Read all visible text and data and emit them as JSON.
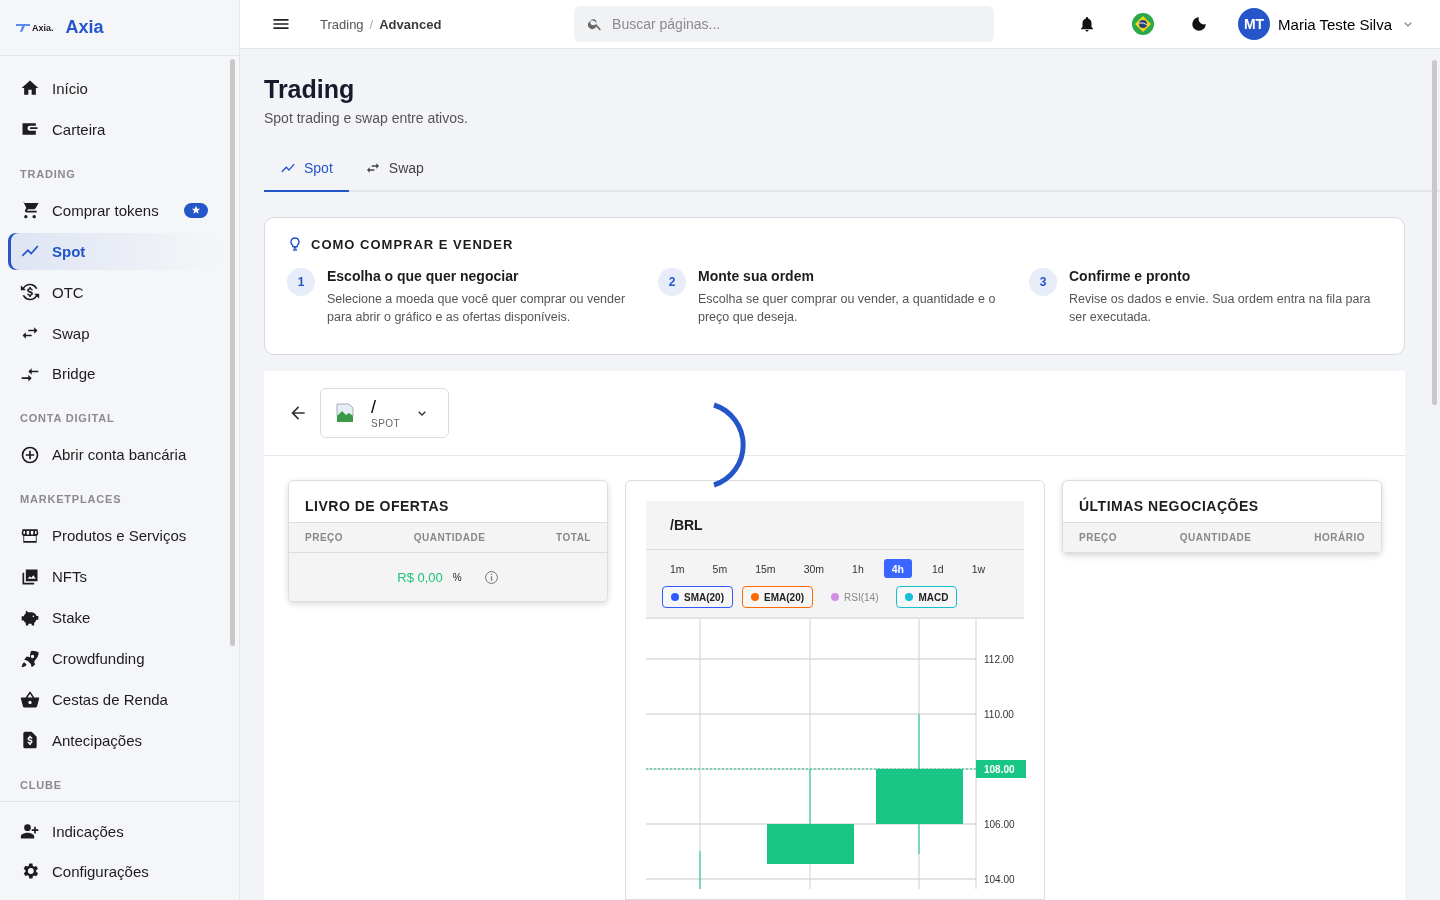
{
  "brand": {
    "name": "Axia",
    "logo_text": "Axia."
  },
  "header": {
    "breadcrumb": [
      "Trading",
      "Advanced"
    ],
    "breadcrumb_separator": "/",
    "search": {
      "placeholder": "Buscar páginas..."
    },
    "user": {
      "initials": "MT",
      "name": "Maria Teste Silva"
    }
  },
  "sidebar": {
    "groups": [
      {
        "items": [
          {
            "label": "Início",
            "selected": false,
            "badge": false
          },
          {
            "label": "Carteira",
            "selected": false,
            "badge": false
          }
        ]
      },
      {
        "title": "TRADING",
        "items": [
          {
            "label": "Comprar tokens",
            "selected": false,
            "badge": true
          },
          {
            "label": "Spot",
            "selected": true,
            "badge": false
          },
          {
            "label": "OTC",
            "selected": false,
            "badge": false
          },
          {
            "label": "Swap",
            "selected": false,
            "badge": false
          },
          {
            "label": "Bridge",
            "selected": false,
            "badge": false
          }
        ]
      },
      {
        "title": "CONTA DIGITAL",
        "items": [
          {
            "label": "Abrir conta bancária",
            "selected": false,
            "badge": false
          }
        ]
      },
      {
        "title": "MARKETPLACES",
        "items": [
          {
            "label": "Produtos e Serviços",
            "selected": false,
            "badge": false
          },
          {
            "label": "NFTs",
            "selected": false,
            "badge": false
          },
          {
            "label": "Stake",
            "selected": false,
            "badge": false
          },
          {
            "label": "Crowdfunding",
            "selected": false,
            "badge": false
          },
          {
            "label": "Cestas de Renda",
            "selected": false,
            "badge": false
          },
          {
            "label": "Antecipações",
            "selected": false,
            "badge": false
          }
        ]
      },
      {
        "title": "CLUBE"
      }
    ],
    "footer": [
      {
        "label": "Indicações",
        "selected": false
      },
      {
        "label": "Configurações",
        "selected": false
      }
    ]
  },
  "page": {
    "title": "Trading",
    "subtitle": "Spot trading e swap entre ativos.",
    "tabs": [
      {
        "label": "Spot",
        "selected": true
      },
      {
        "label": "Swap",
        "selected": false
      }
    ]
  },
  "guide": {
    "title": "COMO COMPRAR E VENDER",
    "steps": [
      {
        "number": "1",
        "title": "Escolha o que quer negociar",
        "text": "Selecione a moeda que você quer comprar ou vender para abrir o gráfico e as ofertas disponíveis."
      },
      {
        "number": "2",
        "title": "Monte sua ordem",
        "text": "Escolha se quer comprar ou vender, a quantidade e o preço que deseja."
      },
      {
        "number": "3",
        "title": "Confirme e pronto",
        "text": "Revise os dados e envie. Sua ordem entra na fila para ser executada."
      }
    ]
  },
  "pair": {
    "symbol": "/",
    "market": "SPOT"
  },
  "order_book": {
    "title": "LIVRO DE OFERTAS",
    "columns": [
      "PREÇO",
      "QUANTIDADE",
      "TOTAL"
    ],
    "price": "R$ 0,00",
    "change": "%"
  },
  "chart": {
    "pair": "/BRL",
    "timeframes": [
      {
        "label": "1m",
        "selected": false
      },
      {
        "label": "5m",
        "selected": false
      },
      {
        "label": "15m",
        "selected": false
      },
      {
        "label": "30m",
        "selected": false
      },
      {
        "label": "1h",
        "selected": false
      },
      {
        "label": "4h",
        "selected": true
      },
      {
        "label": "1d",
        "selected": false
      },
      {
        "label": "1w",
        "selected": false
      }
    ],
    "indicators": [
      {
        "label": "SMA(20)",
        "color": "#2f5bff",
        "active": true
      },
      {
        "label": "EMA(20)",
        "color": "#ff6a00",
        "active": true
      },
      {
        "label": "RSI(14)",
        "color": "#d18ee0",
        "active": false
      },
      {
        "label": "MACD",
        "color": "#17bfd6",
        "active": true
      }
    ],
    "price_axis": [
      {
        "label": "112.00",
        "current": false
      },
      {
        "label": "110.00",
        "current": false
      },
      {
        "label": "108.00",
        "current": true
      },
      {
        "label": "106.00",
        "current": false
      },
      {
        "label": "104.00",
        "current": false
      }
    ]
  },
  "trades": {
    "title": "ÚLTIMAS NEGOCIAÇÕES",
    "columns": [
      "PREÇO",
      "QUANTIDADE",
      "HORÁRIO"
    ]
  }
}
